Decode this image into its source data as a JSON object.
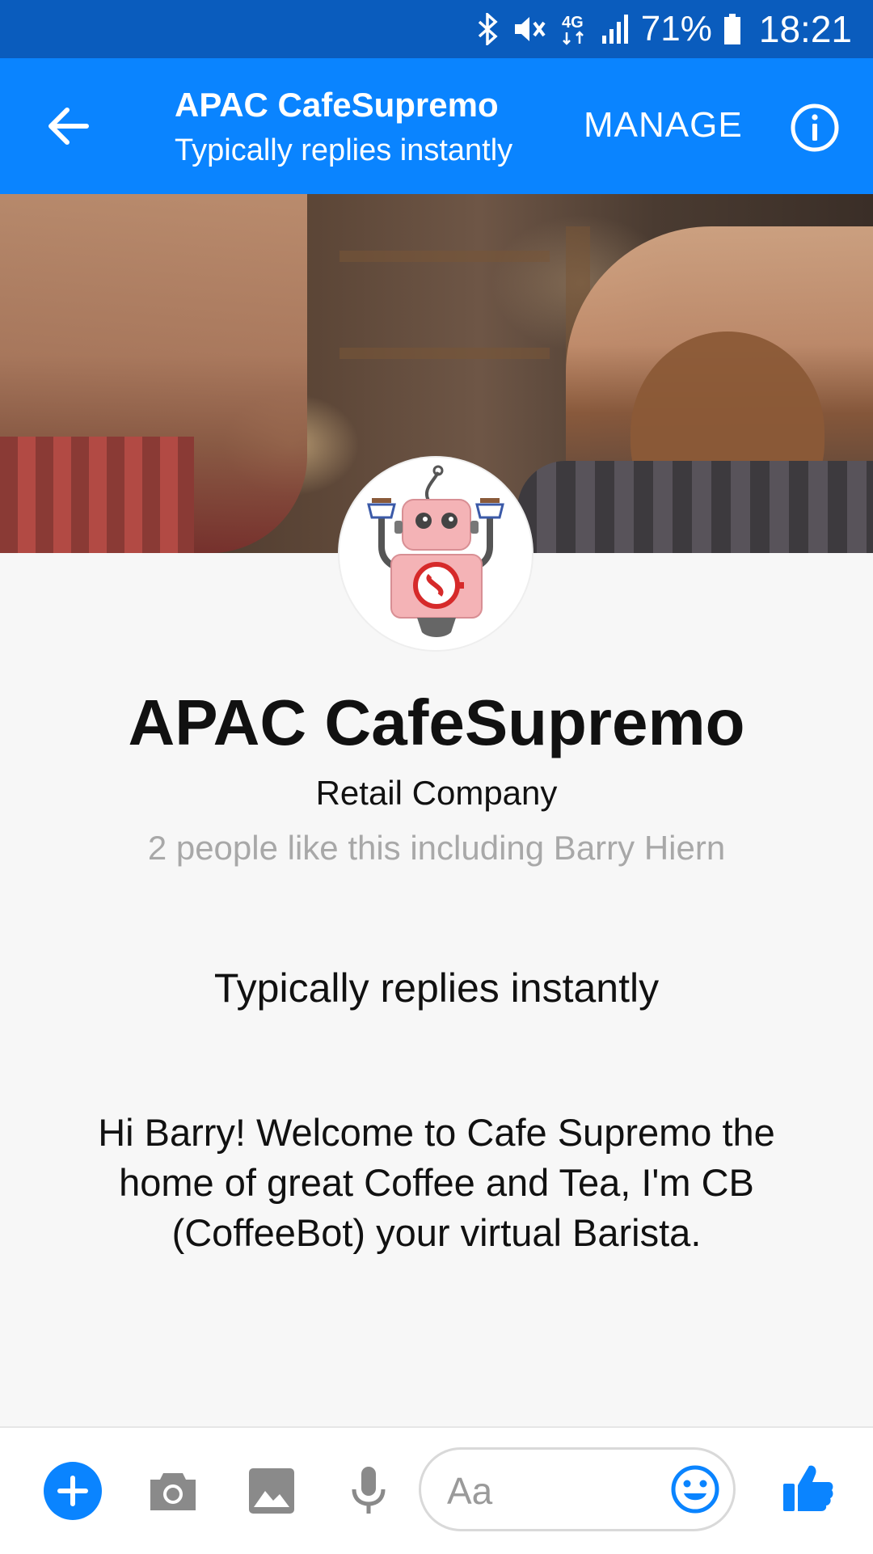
{
  "status_bar": {
    "battery_percent": "71%",
    "time": "18:21",
    "network": "4G",
    "icons": [
      "bluetooth-icon",
      "mute-icon",
      "network-4g-icon",
      "signal-icon",
      "battery-icon"
    ]
  },
  "app_bar": {
    "title": "APAC CafeSupremo",
    "subtitle": "Typically replies instantly",
    "manage_label": "MANAGE",
    "icons": [
      "back-arrow-icon",
      "info-icon"
    ],
    "color": "#0a84ff"
  },
  "profile": {
    "name": "APAC CafeSupremo",
    "category": "Retail Company",
    "likes": "2 people like this including Barry Hiern",
    "response_time": "Typically replies instantly",
    "greeting": "Hi Barry! Welcome to Cafe Supremo the home of great Coffee and Tea, I'm CB (CoffeeBot) your virtual Barista."
  },
  "composer": {
    "placeholder": "Aa",
    "icons": [
      "plus-icon",
      "camera-icon",
      "image-icon",
      "microphone-icon",
      "emoji-icon",
      "thumbs-up-icon"
    ],
    "accent_color": "#0a84ff"
  }
}
